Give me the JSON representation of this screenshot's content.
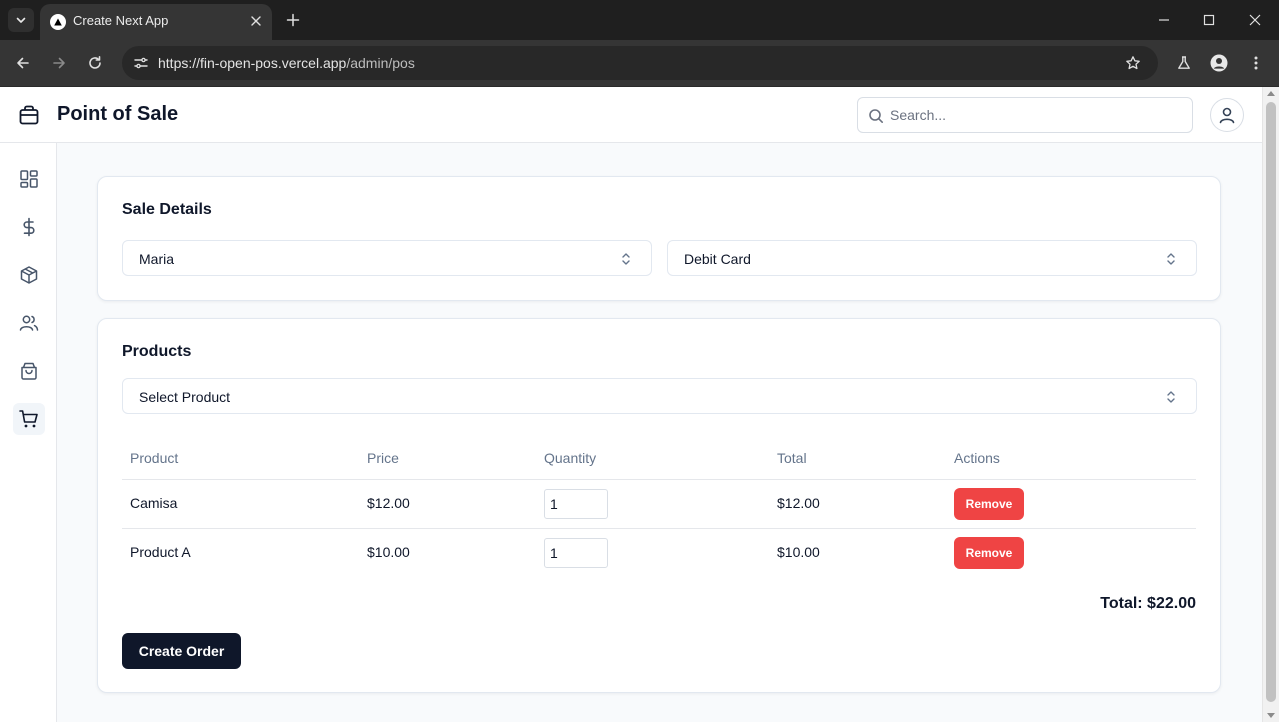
{
  "browser": {
    "tab_title": "Create Next App",
    "url_host": "https://fin-open-pos.vercel.app",
    "url_path": "/admin/pos"
  },
  "header": {
    "title": "Point of Sale",
    "search_placeholder": "Search..."
  },
  "sidebar": {
    "items": [
      {
        "icon": "dashboard-icon",
        "active": false
      },
      {
        "icon": "dollar-icon",
        "active": false
      },
      {
        "icon": "package-icon",
        "active": false
      },
      {
        "icon": "users-icon",
        "active": false
      },
      {
        "icon": "shopping-bag-icon",
        "active": false
      },
      {
        "icon": "cart-icon",
        "active": true
      }
    ]
  },
  "sale_details": {
    "title": "Sale Details",
    "customer": "Maria",
    "payment_method": "Debit Card"
  },
  "products": {
    "title": "Products",
    "select_placeholder": "Select Product",
    "columns": [
      "Product",
      "Price",
      "Quantity",
      "Total",
      "Actions"
    ],
    "rows": [
      {
        "product": "Camisa",
        "price": "$12.00",
        "quantity": "1",
        "total": "$12.00",
        "action": "Remove"
      },
      {
        "product": "Product A",
        "price": "$10.00",
        "quantity": "1",
        "total": "$10.00",
        "action": "Remove"
      }
    ],
    "grand_total": "Total: $22.00",
    "create_label": "Create Order"
  },
  "colors": {
    "primary": "#0f172a",
    "danger": "#ef4444",
    "page_bg": "#f8fafc"
  }
}
